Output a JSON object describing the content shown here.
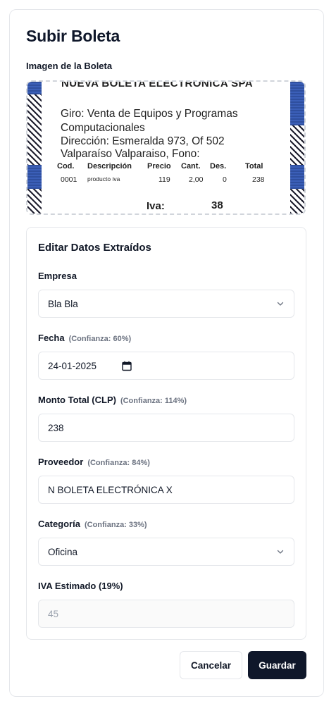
{
  "page": {
    "title": "Subir Boleta"
  },
  "upload": {
    "image_label": "Imagen de la Boleta",
    "receipt": {
      "header": "NUEVA BOLETA ELECTRONICA SPA",
      "lines": [
        "Giro: Venta de Equipos y Programas",
        "Computacionales",
        "Dirección: Esmeralda 973, Of 502",
        "Valparaíso Valparaiso, Fono:"
      ],
      "columns": [
        "Cod.",
        "Descripción",
        "Precio",
        "Cant.",
        "Des.",
        "Total"
      ],
      "row": [
        "0001",
        "producto iva",
        "119",
        "2,00",
        "0",
        "238"
      ],
      "iva_label": "Iva:",
      "iva_value": "38",
      "total_partial": "238"
    }
  },
  "form": {
    "title": "Editar Datos Extraídos",
    "empresa": {
      "label": "Empresa",
      "value": "Bla Bla"
    },
    "fecha": {
      "label": "Fecha",
      "confidence": "(Confianza: 60%)",
      "value": "24-01-2025"
    },
    "monto": {
      "label": "Monto Total (CLP)",
      "confidence": "(Confianza: 114%)",
      "value": "238"
    },
    "proveedor": {
      "label": "Proveedor",
      "confidence": "(Confianza: 84%)",
      "value": "N BOLETA ELECTRÓNICA X"
    },
    "categoria": {
      "label": "Categoría",
      "confidence": "(Confianza: 33%)",
      "value": "Oficina"
    },
    "iva": {
      "label": "IVA Estimado (19%)",
      "value": "45"
    }
  },
  "actions": {
    "cancel": "Cancelar",
    "save": "Guardar"
  },
  "colors": {
    "primary": "#0f172a",
    "border": "#e5e7eb",
    "muted": "#6b7280",
    "receipt_blue": "#2f4f9f"
  },
  "icons": {
    "select": "chevron-down-icon",
    "date": "calendar-icon"
  }
}
